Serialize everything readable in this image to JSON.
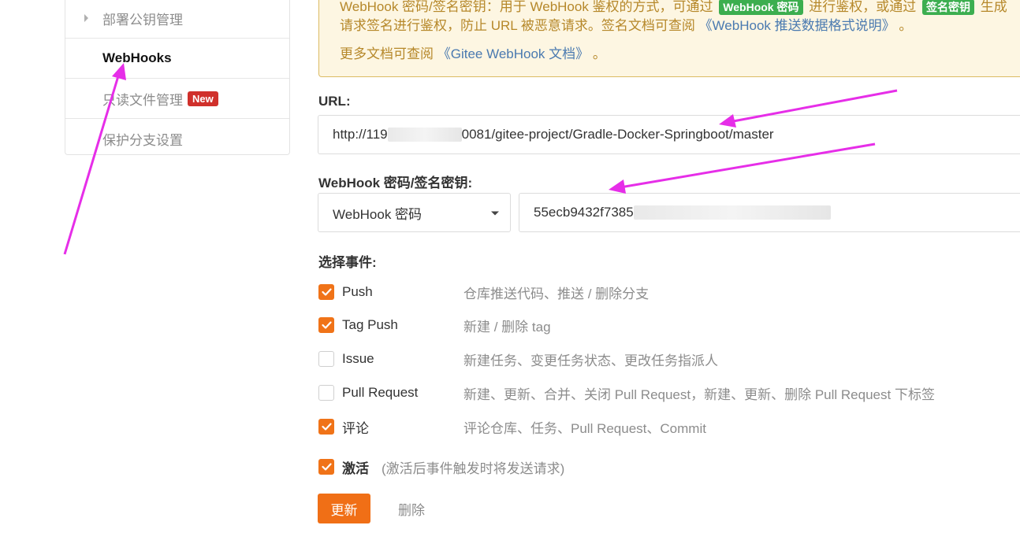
{
  "sidebar": {
    "items": [
      {
        "label": "部署公钥管理"
      },
      {
        "label": "WebHooks"
      },
      {
        "label": "只读文件管理",
        "badge": "New"
      },
      {
        "label": "保护分支设置"
      }
    ]
  },
  "notice": {
    "line1_a": "WebHook 密码/签名密钥：用于 WebHook 鉴权的方式，可通过",
    "tag1": "WebHook 密码",
    "line1_b": "进行鉴权，或通过",
    "tag2": "签名密钥",
    "line1_c": "生成",
    "line2_a": "请求签名进行鉴权，防止 URL 被恶意请求。签名文档可查阅",
    "line2_link": "《WebHook 推送数据格式说明》",
    "line2_b": "。",
    "line3_a": "更多文档可查阅",
    "line3_link": "《Gitee WebHook 文档》",
    "line3_b": "。"
  },
  "form": {
    "url_label": "URL:",
    "url_prefix": "http://119",
    "url_suffix": "0081/gitee-project/Gradle-Docker-Springboot/master",
    "secret_label": "WebHook 密码/签名密钥:",
    "secret_type": "WebHook 密码",
    "secret_value_prefix": "55ecb9432f7385",
    "events_label": "选择事件:",
    "events": [
      {
        "name": "Push",
        "desc": "仓库推送代码、推送 / 删除分支",
        "checked": true
      },
      {
        "name": "Tag Push",
        "desc": "新建 / 删除 tag",
        "checked": true
      },
      {
        "name": "Issue",
        "desc": "新建任务、变更任务状态、更改任务指派人",
        "checked": false
      },
      {
        "name": "Pull Request",
        "desc": "新建、更新、合并、关闭 Pull Request，新建、更新、删除 Pull Request 下标签",
        "checked": false
      },
      {
        "name": "评论",
        "desc": "评论仓库、任务、Pull Request、Commit",
        "checked": true
      }
    ],
    "activate_label": "激活",
    "activate_hint": "(激活后事件触发时将发送请求)",
    "activate_checked": true,
    "update_button": "更新",
    "delete_button": "删除"
  },
  "colors": {
    "accent": "#f06f16",
    "annotation": "#e62ee8"
  }
}
